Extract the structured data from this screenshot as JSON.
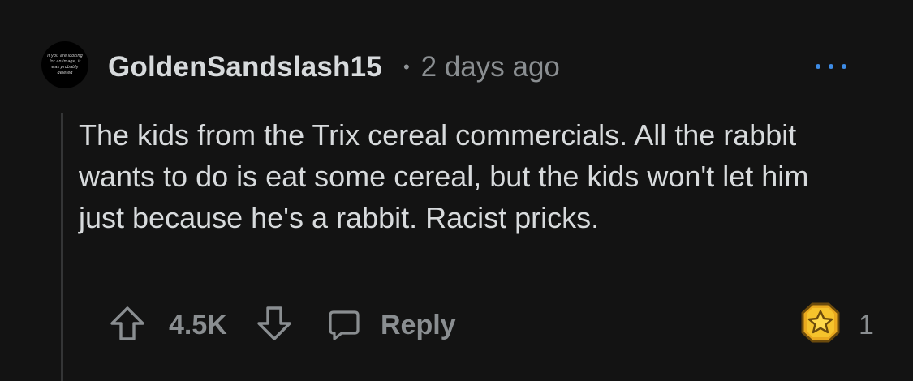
{
  "comment": {
    "avatar_text": "If you are looking for an image, it was probably deleted",
    "username": "GoldenSandslash15",
    "separator": "•",
    "timestamp": "2 days ago",
    "body": "The kids from the Trix cereal commercials. All the rabbit wants to do is eat some cereal, but the kids won't let him just because he's a rabbit. Racist pricks.",
    "votes": "4.5K",
    "reply_label": "Reply",
    "award_count": "1"
  },
  "icons": {
    "more": "more-options-icon",
    "upvote": "upvote-arrow-icon",
    "downvote": "downvote-arrow-icon",
    "reply": "speech-bubble-icon",
    "award": "star-award-icon"
  },
  "colors": {
    "background": "#131313",
    "text": "#d7dadc",
    "muted": "#8a8e91",
    "accent": "#3e8ce6",
    "award_gold": "#f5c32c",
    "thread_line": "#343536"
  }
}
